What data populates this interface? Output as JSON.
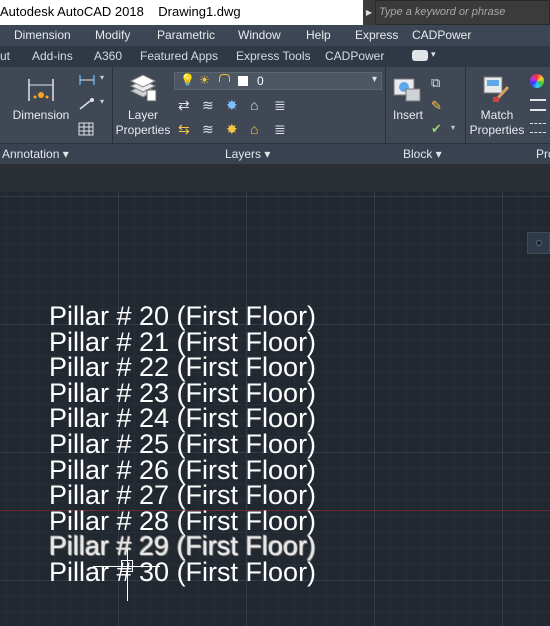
{
  "titlebar": {
    "title": "Autodesk AutoCAD 2018    Drawing1.dwg"
  },
  "search": {
    "placeholder": "Type a keyword or phrase"
  },
  "menubar": {
    "items": [
      "Dimension",
      "Modify",
      "Parametric",
      "Window",
      "Help",
      "Express",
      "CADPower"
    ]
  },
  "tabs": {
    "items": [
      "ut",
      "Add-ins",
      "A360",
      "Featured Apps",
      "Express Tools",
      "CADPower"
    ]
  },
  "ribbon": {
    "dimension_label": "Dimension",
    "layer_properties_label": "Layer\nProperties",
    "layer_dropdown_value": "0",
    "insert_label": "Insert",
    "match_properties_label": "Match\nProperties"
  },
  "panels": {
    "annotation": "Annotation ▾",
    "layers": "Layers ▾",
    "block": "Block ▾",
    "properties": "Pro"
  },
  "drawing": {
    "lines": [
      "Pillar # 20 (First Floor)",
      "Pillar # 21 (First Floor)",
      "Pillar # 22 (First Floor)",
      "Pillar # 23 (First Floor)",
      "Pillar # 24 (First Floor)",
      "Pillar # 25 (First Floor)",
      "Pillar # 26 (First Floor)",
      "Pillar # 27 (First Floor)",
      "Pillar # 28 (First Floor)",
      "Pillar # 29 (First Floor)",
      "Pillar # 30 (First Floor)"
    ]
  },
  "colors": {
    "canvas": "#212830",
    "ribbon": "#3f4854",
    "menubar": "#3c4654",
    "x_axis": "#6a2a30",
    "text": "#ffffff"
  },
  "icons": [
    "dimension-icon",
    "linear-dimension-icon",
    "leader-icon",
    "table-icon",
    "layer-properties-icon",
    "lightbulb-icon",
    "sun-icon",
    "lock-icon",
    "color-swatch-icon",
    "insert-block-icon",
    "match-properties-icon"
  ]
}
